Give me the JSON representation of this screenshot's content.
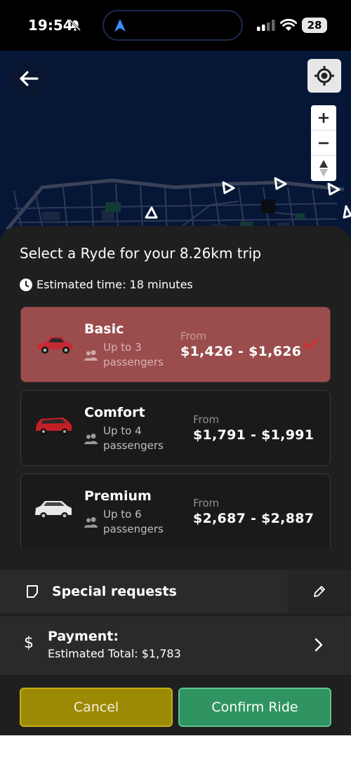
{
  "status_bar": {
    "time": "19:54",
    "battery": "28",
    "icons": [
      "bell-off-icon",
      "navigation-arrow-icon",
      "signal-icon",
      "wifi-icon",
      "battery-icon"
    ]
  },
  "map": {
    "controls": [
      "back-arrow-icon",
      "locate-icon",
      "zoom-in-icon",
      "zoom-out-icon",
      "compass-icon"
    ]
  },
  "sheet": {
    "title": "Select a Ryde for your 8.26km trip",
    "estimated_time": "Estimated time: 18 minutes",
    "rides": [
      {
        "name": "Basic",
        "passengers": "Up to 3 passengers",
        "from_label": "From",
        "price": "$1,426 - $1,626",
        "selected": true,
        "car_color": "#c42b35"
      },
      {
        "name": "Comfort",
        "passengers": "Up to 4 passengers",
        "from_label": "From",
        "price": "$1,791 - $1,991",
        "selected": false,
        "car_color": "#c42024"
      },
      {
        "name": "Premium",
        "passengers": "Up to 6 passengers",
        "from_label": "From",
        "price": "$2,687 - $2,887",
        "selected": false,
        "car_color": "#e8e8e8"
      }
    ],
    "special_requests": "Special requests",
    "payment": {
      "label": "Payment:",
      "total": "Estimated Total: $1,783"
    },
    "cancel_label": "Cancel",
    "confirm_label": "Confirm Ride"
  },
  "colors": {
    "selected_card": "#9b4d4d",
    "cancel_button": "#9c8a05",
    "confirm_button": "#2f9461",
    "map_background": "#061637",
    "sheet_background": "#1f1f1f"
  }
}
